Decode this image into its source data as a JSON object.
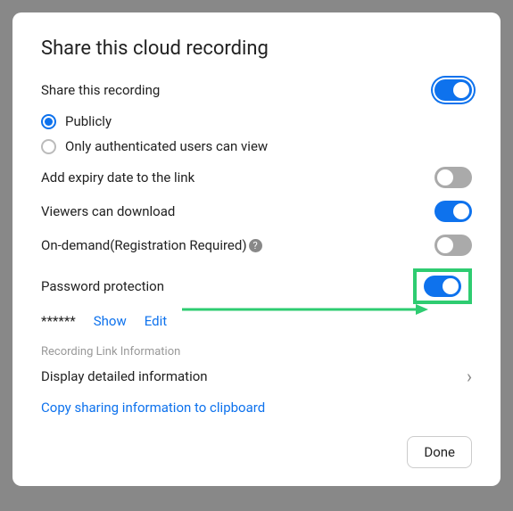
{
  "title": "Share this cloud recording",
  "share": {
    "label": "Share this recording",
    "options": {
      "public": "Publicly",
      "auth": "Only authenticated users can view"
    }
  },
  "expiry": {
    "label": "Add expiry date to the link"
  },
  "download": {
    "label": "Viewers can download"
  },
  "ondemand": {
    "label": "On-demand(Registration Required)"
  },
  "password": {
    "label": "Password protection",
    "mask": "******",
    "show": "Show",
    "edit": "Edit"
  },
  "linkinfo": {
    "section": "Recording Link Information",
    "detail": "Display detailed information",
    "copy": "Copy sharing information to clipboard"
  },
  "done": "Done",
  "help": "?"
}
